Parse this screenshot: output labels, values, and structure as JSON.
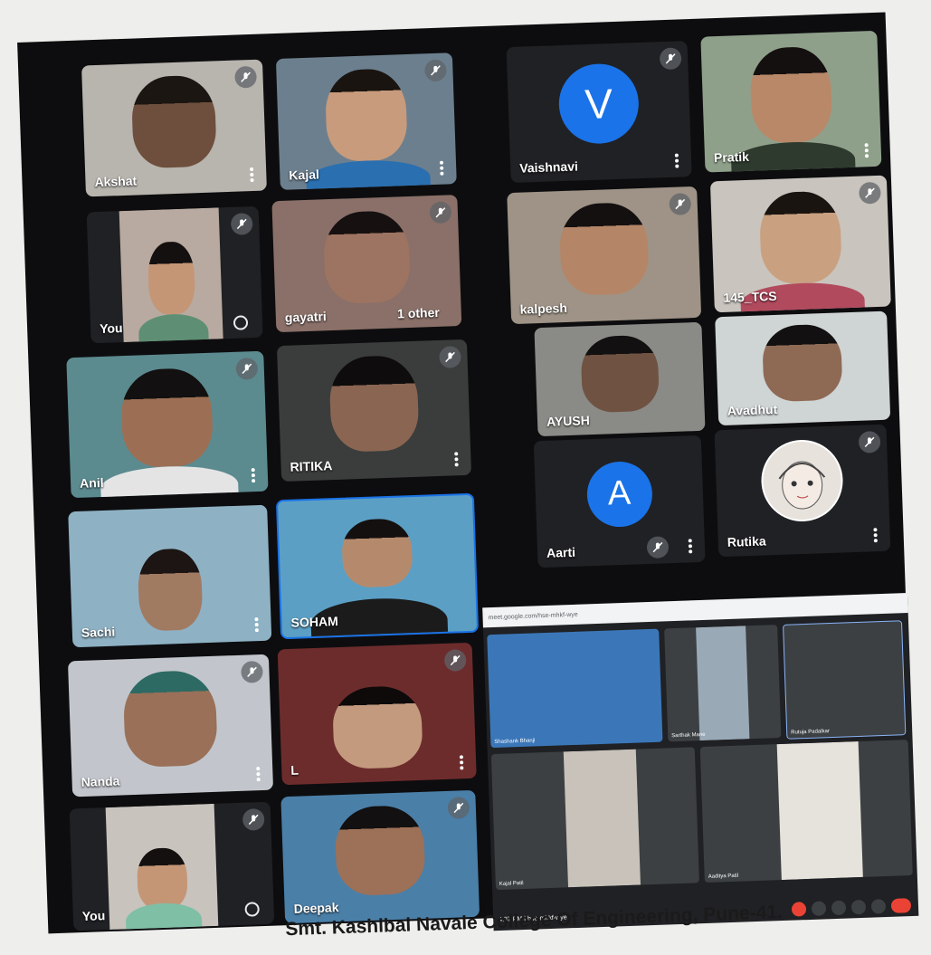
{
  "meeting": {
    "participants": [
      {
        "name": "Akshat",
        "muted": true
      },
      {
        "name": "Kajal",
        "muted": true
      },
      {
        "name": "Vaishnavi",
        "muted": true,
        "avatar_letter": "V"
      },
      {
        "name": "Pratik",
        "muted": false
      },
      {
        "name": "You",
        "muted": true
      },
      {
        "name": "gayatri",
        "muted": true,
        "extra": "1 other"
      },
      {
        "name": "kalpesh",
        "muted": true
      },
      {
        "name": "145_TCS",
        "muted": true
      },
      {
        "name": "AYUSH",
        "muted": false
      },
      {
        "name": "Avadhut",
        "muted": false
      },
      {
        "name": "Anil",
        "muted": true
      },
      {
        "name": "RITIKA",
        "muted": true
      },
      {
        "name": "Aarti",
        "muted": true,
        "avatar_letter": "A"
      },
      {
        "name": "Rutika",
        "muted": true
      },
      {
        "name": "Sachi",
        "muted": false
      },
      {
        "name": "SOHAM",
        "muted": false
      },
      {
        "name": "Nanda",
        "muted": true
      },
      {
        "name": "L",
        "muted": true
      },
      {
        "name": "You",
        "muted": true
      },
      {
        "name": "Deepak",
        "muted": true
      }
    ],
    "embedded_screenshot": {
      "url": "meet.google.com/hse-mhkf-wye",
      "participants": [
        "Shashank Bhanji",
        "Sarthak Mane",
        "Rutuja Padalkar",
        "Kajal Patil",
        "Aaditya Patil"
      ],
      "clock": "4:37 PM",
      "meeting_code": "hse-mhkf-wye"
    }
  },
  "caption": "Smt. Kashibai Navale College Of Engineering, Pune-41.",
  "colors": {
    "meet_blue": "#1a73e8",
    "tile_bg": "#202124",
    "end_call_red": "#ea4335"
  }
}
